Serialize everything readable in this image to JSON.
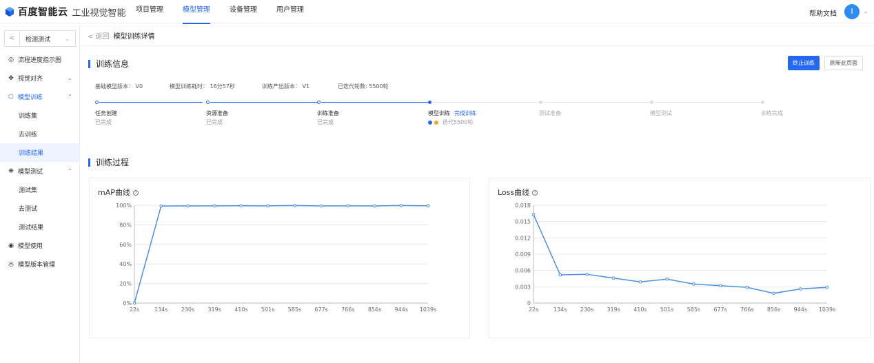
{
  "app": {
    "brand": "百度智能云",
    "product": "工业视觉智能",
    "nav": [
      "项目管理",
      "模型管理",
      "设备管理",
      "用户管理"
    ],
    "help": "帮助文档",
    "avatar": "I"
  },
  "sidebar": {
    "workspace": "检测测试",
    "items": [
      {
        "label": "流程进度指示图",
        "icon": "flow-icon"
      },
      {
        "label": "视觉对齐",
        "icon": "align-icon"
      },
      {
        "label": "模型训练",
        "icon": "train-icon"
      },
      {
        "label": "训练集"
      },
      {
        "label": "去训练"
      },
      {
        "label": "训练结果"
      },
      {
        "label": "模型测试",
        "icon": "test-icon"
      },
      {
        "label": "测试集"
      },
      {
        "label": "去测试"
      },
      {
        "label": "测试结果"
      },
      {
        "label": "模型使用",
        "icon": "use-icon"
      },
      {
        "label": "模型版本管理",
        "icon": "version-icon"
      }
    ]
  },
  "breadcrumb": {
    "back": "返回",
    "title": "模型训练详情"
  },
  "training_info": {
    "title": "训练信息",
    "stop_button": "终止训练",
    "refresh_button": "刷新此页面",
    "base_version": "基础模型版本： V0",
    "duration": "模型训练耗时： 16分57秒",
    "output_version": "训练产出版本： V1",
    "rounds": "已迭代轮数: 5500轮"
  },
  "steps": [
    {
      "name": "任务创建",
      "state": "已完成",
      "status": "done"
    },
    {
      "name": "资源准备",
      "state": "已完成",
      "status": "done"
    },
    {
      "name": "训练准备",
      "state": "已完成",
      "status": "done"
    },
    {
      "name": "模型训练",
      "tag": "完成训练",
      "state": "迭代5500轮",
      "status": "current"
    },
    {
      "name": "测试准备",
      "state": "",
      "status": "todo"
    },
    {
      "name": "模型测试",
      "state": "",
      "status": "todo"
    },
    {
      "name": "训练完成",
      "state": "",
      "status": "todo"
    }
  ],
  "process": {
    "title": "训练过程"
  },
  "colors": {
    "accent": "#2468f2",
    "line": "#4a90e2",
    "orange": "#f5a623"
  },
  "chart_data": [
    {
      "type": "line",
      "title": "mAP曲线",
      "x": [
        "22s",
        "134s",
        "230s",
        "319s",
        "410s",
        "501s",
        "585s",
        "677s",
        "766s",
        "856s",
        "944s",
        "1039s"
      ],
      "values": [
        0,
        99.2,
        99.3,
        99.4,
        99.5,
        99.4,
        99.7,
        99.3,
        99.4,
        99.3,
        99.7,
        99.4
      ],
      "yticks": [
        "0%",
        "20%",
        "40%",
        "60%",
        "80%",
        "100%"
      ],
      "ylim": [
        0,
        100
      ],
      "grid": true
    },
    {
      "type": "line",
      "title": "Loss曲线",
      "x": [
        "22s",
        "134s",
        "230s",
        "319s",
        "410s",
        "501s",
        "585s",
        "677s",
        "766s",
        "856s",
        "944s",
        "1039s"
      ],
      "values": [
        0.0163,
        0.0052,
        0.0053,
        0.0046,
        0.0039,
        0.0044,
        0.0035,
        0.0032,
        0.0029,
        0.0018,
        0.0026,
        0.0029
      ],
      "yticks": [
        "0",
        "0.003",
        "0.006",
        "0.009",
        "0.012",
        "0.015",
        "0.018"
      ],
      "ylim": [
        0,
        0.018
      ],
      "grid": true
    }
  ]
}
